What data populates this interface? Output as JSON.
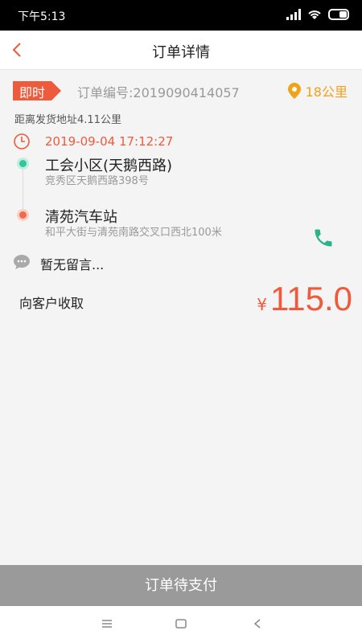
{
  "status": {
    "time": "下午5:13"
  },
  "nav": {
    "title": "订单详情"
  },
  "order": {
    "tag": "即时",
    "number_text": "订单编号:2019090414057",
    "distance_badge": "18公里",
    "distance_line": "距离发货地址4.11公里",
    "datetime": "2019-09-04 17:12:27",
    "from": {
      "name": "工会小区(天鹅西路)",
      "address": "竞秀区天鹅西路398号"
    },
    "to": {
      "name": "清苑汽车站",
      "address": "和平大街与清苑南路交叉口西北100米"
    },
    "message": "暂无留言...",
    "collect_label": "向客户收取",
    "currency": "¥",
    "amount": "115.0"
  },
  "footer": {
    "pay_button": "订单待支付"
  },
  "colors": {
    "accent": "#ee5a3c",
    "orange": "#f0a21a",
    "green": "#32c79a",
    "gray_button": "#9a9a9a"
  },
  "icons": [
    "back-chevron-icon",
    "location-pin-icon",
    "clock-icon",
    "phone-icon",
    "chat-bubble-icon",
    "menu-icon",
    "home-icon",
    "back-icon",
    "signal-icon",
    "wifi-icon",
    "battery-icon"
  ]
}
